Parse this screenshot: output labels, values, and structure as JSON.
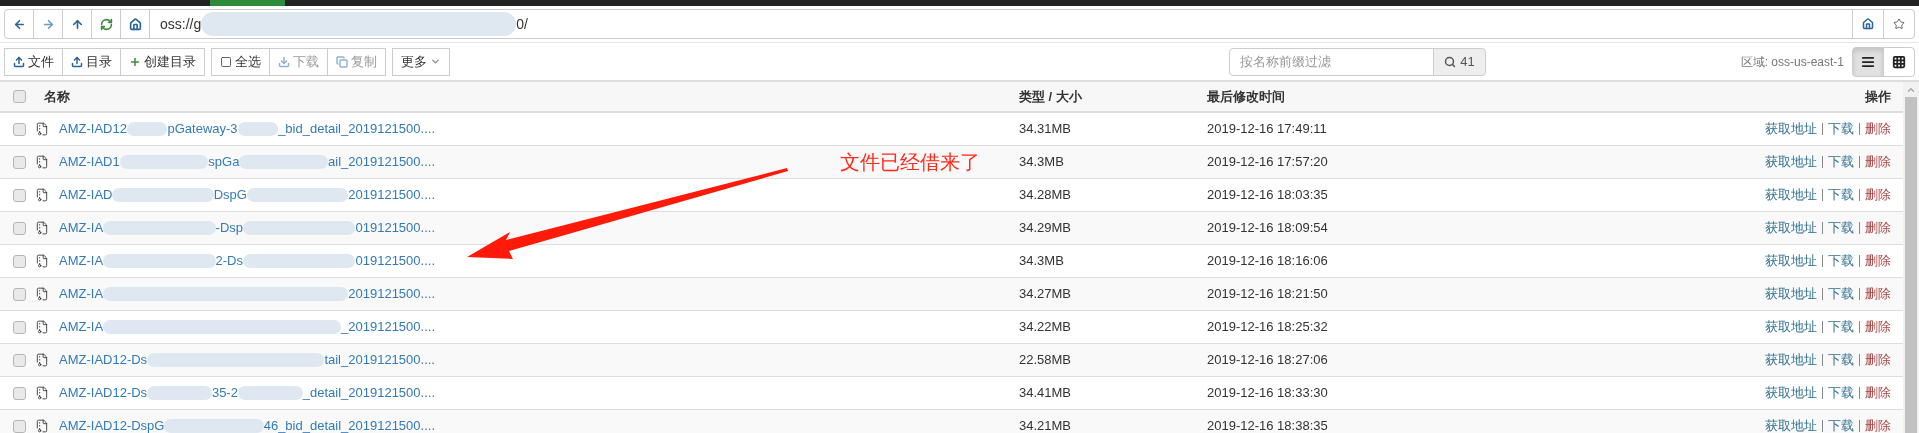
{
  "nav": {
    "buttons": [
      {
        "kind": "back"
      },
      {
        "kind": "forward"
      },
      {
        "kind": "up"
      },
      {
        "kind": "refresh"
      },
      {
        "kind": "home"
      }
    ],
    "address": {
      "parts": [
        "oss://g",
        "0/"
      ]
    },
    "right_buttons": [
      {
        "kind": "home"
      },
      {
        "kind": "star"
      }
    ]
  },
  "toolbar": {
    "groups": [
      [
        {
          "label": "文件",
          "kind": "upload",
          "disabled": false
        },
        {
          "label": "目录",
          "kind": "upload",
          "disabled": false
        },
        {
          "label": "创建目录",
          "kind": "plus",
          "disabled": false
        }
      ],
      [
        {
          "label": "全选",
          "kind": "checkbox",
          "disabled": false
        },
        {
          "label": "下载",
          "kind": "download",
          "disabled": true
        },
        {
          "label": "复制",
          "kind": "copy",
          "disabled": true
        }
      ],
      [
        {
          "label": "更多",
          "kind": "dropdown",
          "disabled": false
        }
      ]
    ],
    "filter": {
      "placeholder": "按名称前缀过滤"
    },
    "count": "41",
    "region": "区域: oss-us-east-1",
    "views": [
      {
        "kind": "list",
        "selected": true
      },
      {
        "kind": "grid",
        "selected": false
      }
    ]
  },
  "table": {
    "columns": [
      "名称",
      "类型 / 大小",
      "最后修改时间",
      "操作"
    ],
    "select_all": {
      "checked": false
    },
    "rows": [
      {
        "checked": false,
        "name_parts": [
          "AMZ-IAD12",
          "pGateway-3",
          "_bid_detail_2019121500...."
        ],
        "size": "34.31MB",
        "modified": "2019-12-16 17:49:11",
        "actions": [
          {
            "label": "获取地址",
            "kind": "link"
          },
          {
            "label": "下载",
            "kind": "link"
          },
          {
            "label": "删除",
            "kind": "danger"
          }
        ]
      },
      {
        "checked": false,
        "name_parts": [
          "AMZ-IAD1",
          "spGa",
          "ail_2019121500...."
        ],
        "size": "34.3MB",
        "modified": "2019-12-16 17:57:20",
        "actions": [
          {
            "label": "获取地址",
            "kind": "link"
          },
          {
            "label": "下载",
            "kind": "link"
          },
          {
            "label": "删除",
            "kind": "danger"
          }
        ]
      },
      {
        "checked": false,
        "name_parts": [
          "AMZ-IAD",
          "DspG",
          "2019121500...."
        ],
        "size": "34.28MB",
        "modified": "2019-12-16 18:03:35",
        "actions": [
          {
            "label": "获取地址",
            "kind": "link"
          },
          {
            "label": "下载",
            "kind": "link"
          },
          {
            "label": "删除",
            "kind": "danger"
          }
        ]
      },
      {
        "checked": false,
        "name_parts": [
          "AMZ-IA",
          "-Dsp",
          "019121500...."
        ],
        "size": "34.29MB",
        "modified": "2019-12-16 18:09:54",
        "actions": [
          {
            "label": "获取地址",
            "kind": "link"
          },
          {
            "label": "下载",
            "kind": "link"
          },
          {
            "label": "删除",
            "kind": "danger"
          }
        ]
      },
      {
        "checked": false,
        "name_parts": [
          "AMZ-IA",
          "2-Ds",
          "019121500...."
        ],
        "size": "34.3MB",
        "modified": "2019-12-16 18:16:06",
        "actions": [
          {
            "label": "获取地址",
            "kind": "link"
          },
          {
            "label": "下载",
            "kind": "link"
          },
          {
            "label": "删除",
            "kind": "danger"
          }
        ]
      },
      {
        "checked": false,
        "name_parts": [
          "AMZ-IA",
          "2019121500...."
        ],
        "size": "34.27MB",
        "modified": "2019-12-16 18:21:50",
        "actions": [
          {
            "label": "获取地址",
            "kind": "link"
          },
          {
            "label": "下载",
            "kind": "link"
          },
          {
            "label": "删除",
            "kind": "danger"
          }
        ]
      },
      {
        "checked": false,
        "name_parts": [
          "AMZ-IA",
          "_2019121500...."
        ],
        "size": "34.22MB",
        "modified": "2019-12-16 18:25:32",
        "actions": [
          {
            "label": "获取地址",
            "kind": "link"
          },
          {
            "label": "下载",
            "kind": "link"
          },
          {
            "label": "删除",
            "kind": "danger"
          }
        ]
      },
      {
        "checked": false,
        "name_parts": [
          "AMZ-IAD12-Ds",
          "tail_2019121500...."
        ],
        "size": "22.58MB",
        "modified": "2019-12-16 18:27:06",
        "actions": [
          {
            "label": "获取地址",
            "kind": "link"
          },
          {
            "label": "下载",
            "kind": "link"
          },
          {
            "label": "删除",
            "kind": "danger"
          }
        ]
      },
      {
        "checked": false,
        "name_parts": [
          "AMZ-IAD12-Ds",
          "35-2",
          "_detail_2019121500...."
        ],
        "size": "34.41MB",
        "modified": "2019-12-16 18:33:30",
        "actions": [
          {
            "label": "获取地址",
            "kind": "link"
          },
          {
            "label": "下载",
            "kind": "link"
          },
          {
            "label": "删除",
            "kind": "danger"
          }
        ]
      },
      {
        "checked": false,
        "name_parts": [
          "AMZ-IAD12-DspG",
          "46_bid_detail_2019121500...."
        ],
        "size": "34.21MB",
        "modified": "2019-12-16 18:38:35",
        "actions": [
          {
            "label": "获取地址",
            "kind": "link"
          },
          {
            "label": "下载",
            "kind": "link"
          },
          {
            "label": "删除",
            "kind": "danger"
          }
        ]
      }
    ]
  },
  "annotation": {
    "text": "文件已经借来了"
  }
}
